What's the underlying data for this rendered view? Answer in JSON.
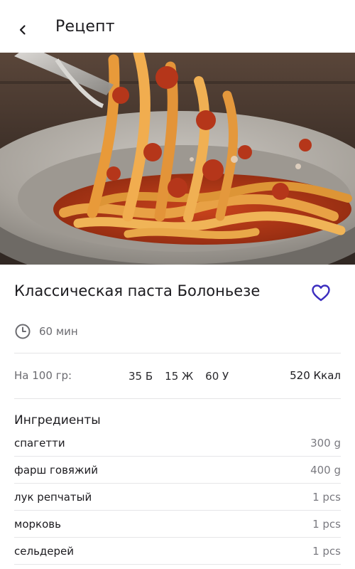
{
  "header": {
    "title": "Рецепт",
    "back_icon": "chevron-left-icon"
  },
  "hero": {
    "image_subject": "pasta-bolognese-photo"
  },
  "recipe": {
    "title": "Классическая паста Болоньезе",
    "favorite_icon": "heart-outline-icon",
    "accent_color": "#3b2dbf",
    "time_icon": "clock-icon",
    "time": "60 мин"
  },
  "nutrition": {
    "label": "На 100 гр:",
    "protein": "35 Б",
    "fat": "15 Ж",
    "carbs": "60 У",
    "kcal": "520 Ккал"
  },
  "ingredients": {
    "title": "Ингредиенты",
    "items": [
      {
        "name": "спагетти",
        "qty": "300 g"
      },
      {
        "name": "фарш говяжий",
        "qty": "400 g"
      },
      {
        "name": "лук репчатый",
        "qty": "1 pcs"
      },
      {
        "name": "морковь",
        "qty": "1 pcs"
      },
      {
        "name": "сельдерей",
        "qty": "1 pcs"
      }
    ]
  }
}
